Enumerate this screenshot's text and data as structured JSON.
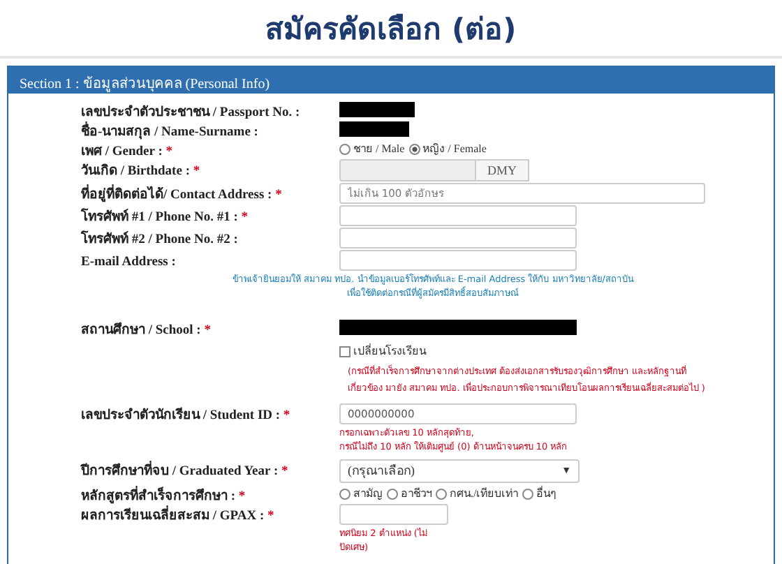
{
  "page_title": "สมัครคัดเลือก (ต่อ)",
  "section": {
    "title": "Section 1 : ข้อมูลส่วนบุคคล (Personal Info)"
  },
  "fields": [
    {
      "kind": "redacted",
      "label": "เลขประจำตัวประชาชน / Passport No. :",
      "required": false
    },
    {
      "kind": "redacted",
      "label": "ชื่อ-นามสกุล / Name-Surname :",
      "required": false
    },
    {
      "kind": "radio",
      "label": "เพศ / Gender :",
      "required": true,
      "options": [
        {
          "label": "ชาย / Male",
          "selected": false
        },
        {
          "label": "หญิง / Female",
          "selected": true
        }
      ]
    },
    {
      "kind": "date",
      "label": "วันเกิด / Birthdate :",
      "required": true,
      "addon": "DMY",
      "disabled": true
    },
    {
      "kind": "longtext",
      "label": "ที่อยู่ที่ติดต่อได้/ Contact Address :",
      "required": true,
      "placeholder": "ไม่เกิน 100 ตัวอักษร"
    },
    {
      "kind": "text",
      "label": "โทรศัพท์ #1 / Phone No. #1 :",
      "required": true
    },
    {
      "kind": "text",
      "label": "โทรศัพท์ #2 / Phone No. #2 :",
      "required": false
    },
    {
      "kind": "text",
      "label": "E-mail Address :",
      "required": false
    },
    {
      "kind": "note",
      "color": "#1a7fb5",
      "lines": [
        "ข้าพเจ้ายินยอมให้ สมาคม ทปอ. นำข้อมูลเบอร์โทรศัพท์และ E-mail Address ให้กับ มหาวิทยาลัย/สถาบัน",
        "เพื่อใช้ติดต่อกรณีที่ผู้สมัครมีสิทธิ์สอบสัมภาษณ์"
      ]
    },
    {
      "kind": "redacted",
      "label": "สถานศึกษา / School :",
      "required": true
    },
    {
      "kind": "checkbox",
      "label": "เปลี่ยนโรงเรียน",
      "checked": false
    },
    {
      "kind": "warning",
      "color": "#d0021b",
      "lines": [
        "(กรณีที่สำเร็จการศึกษาจากต่างประเทศ ต้องส่งเอกสารรับรองวุฒิการศึกษา และหลักฐานที่",
        "เกี่ยวข้อง มายัง สมาคม ทปอ. เพื่อประกอบการพิจารณาเทียบโอนผลการเรียนเฉลี่ยสะสมต่อไป )"
      ]
    },
    {
      "kind": "text",
      "label": "เลขประจำตัวนักเรียน / Student ID :",
      "required": true,
      "value": "0000000000",
      "hint": [
        "กรอกเฉพาะตัวเลข 10 หลักสุดท้าย,",
        "กรณีไม่ถึง 10 หลัก ให้เติมศูนย์ (0) ด้านหน้าจนครบ 10 หลัก"
      ]
    },
    {
      "kind": "select",
      "label": "ปีการศึกษาที่จบ / Graduated Year :",
      "required": true,
      "value": "(กรุณาเลือก)",
      "caret": "▼"
    },
    {
      "kind": "radio",
      "label": "หลักสูตรที่สำเร็จการศึกษา :",
      "required": true,
      "options": [
        {
          "label": "สามัญ",
          "selected": false
        },
        {
          "label": "อาชีวฯ",
          "selected": false
        },
        {
          "label": "กศน./เทียบเท่า",
          "selected": false
        },
        {
          "label": "อื่นๆ",
          "selected": false
        }
      ]
    },
    {
      "kind": "shorttext",
      "label": "ผลการเรียนเฉลี่ยสะสม / GPAX :",
      "required": true,
      "hint": [
        "ทศนิยม 2 ตำแหน่ง (ไม่",
        "ปัดเศษ)"
      ]
    }
  ],
  "required_mark": "*"
}
